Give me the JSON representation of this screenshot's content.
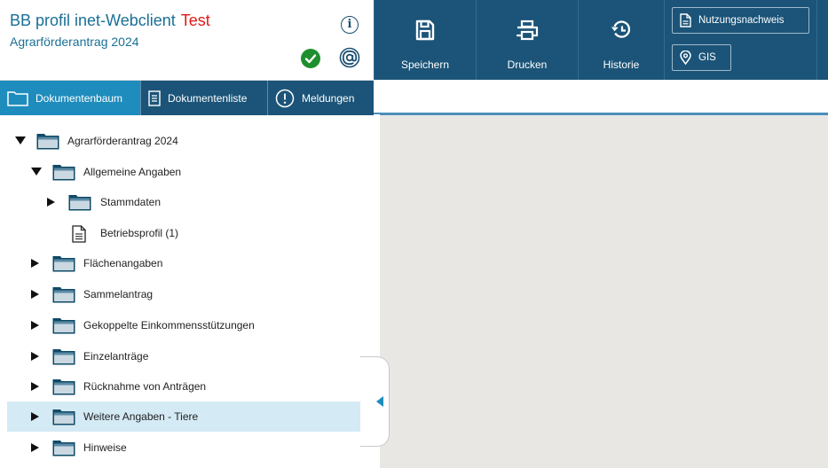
{
  "header": {
    "app_name": "BB profil inet-Webclient",
    "env_label": "Test",
    "subtitle": "Agrarförderantrag 2024",
    "info_icon": "info-icon",
    "status_icon": "check-circle-icon",
    "mail_icon": "at-sign-icon",
    "colors": {
      "title": "#1a6f96",
      "env": "#e11818",
      "ok": "#1e8f2e"
    }
  },
  "tabs": [
    {
      "label": "Dokumentenbaum",
      "icon": "folder-icon",
      "active": true
    },
    {
      "label": "Dokumentenliste",
      "icon": "list-icon",
      "active": false
    },
    {
      "label": "Meldungen",
      "icon": "exclamation-circle-icon",
      "active": false
    }
  ],
  "toolbar": {
    "save_label": "Speichern",
    "print_label": "Drucken",
    "history_label": "Historie",
    "usage_label": "Nutzungsnachweis",
    "gis_label": "GIS",
    "colors": {
      "bar": "#1b5478",
      "active_tab": "#1e8cbd"
    }
  },
  "tree": [
    {
      "label": "Agrarförderantrag 2024",
      "level": 0,
      "expander": "down",
      "icon": "folder-icon"
    },
    {
      "label": "Allgemeine Angaben",
      "level": 1,
      "expander": "down",
      "icon": "folder-icon"
    },
    {
      "label": "Stammdaten",
      "level": 2,
      "expander": "right",
      "icon": "folder-icon"
    },
    {
      "label": "Betriebsprofil (1)",
      "level": 2,
      "expander": "none",
      "icon": "document-icon"
    },
    {
      "label": "Flächenangaben",
      "level": 1,
      "expander": "right",
      "icon": "folder-icon"
    },
    {
      "label": "Sammelantrag",
      "level": 1,
      "expander": "right",
      "icon": "folder-icon"
    },
    {
      "label": "Gekoppelte Einkommensstützungen",
      "level": 1,
      "expander": "right",
      "icon": "folder-icon"
    },
    {
      "label": "Einzelanträge",
      "level": 1,
      "expander": "right",
      "icon": "folder-icon"
    },
    {
      "label": "Rücknahme von Anträgen",
      "level": 1,
      "expander": "right",
      "icon": "folder-icon"
    },
    {
      "label": "Weitere Angaben - Tiere",
      "level": 1,
      "expander": "right",
      "icon": "folder-icon",
      "selected": true
    },
    {
      "label": "Hinweise",
      "level": 1,
      "expander": "right",
      "icon": "folder-icon"
    }
  ],
  "splitter": {
    "icon": "collapse-left-icon"
  }
}
